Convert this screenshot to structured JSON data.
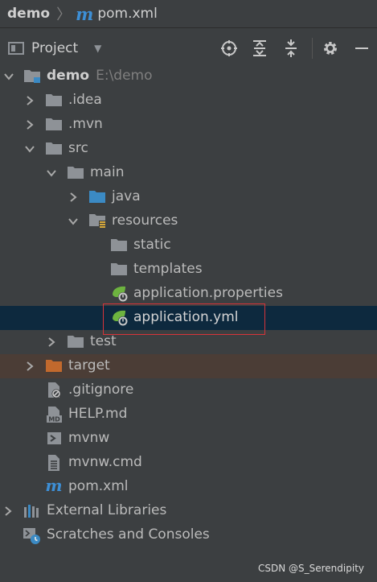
{
  "breadcrumb": {
    "project": "demo",
    "separator": "〉",
    "file_icon": "m",
    "file": "pom.xml"
  },
  "toolbar": {
    "title": "Project",
    "dropdown": "▼",
    "buttons": [
      "locate-icon",
      "expand-all-icon",
      "collapse-all-icon",
      "gear-icon",
      "minimize-icon"
    ]
  },
  "tree": {
    "root": {
      "label": "demo",
      "path": "E:\\demo"
    },
    "idea": ".idea",
    "mvn": ".mvn",
    "src": "src",
    "main": "main",
    "java": "java",
    "resources": "resources",
    "static": "static",
    "templates": "templates",
    "app_props": "application.properties",
    "app_yml": "application.yml",
    "test": "test",
    "target": "target",
    "gitignore": ".gitignore",
    "help": "HELP.md",
    "mvnw": "mvnw",
    "mvnw_cmd": "mvnw.cmd",
    "pom": "pom.xml",
    "ext_libs": "External Libraries",
    "scratches": "Scratches and Consoles"
  },
  "colors": {
    "background": "#3c3f41",
    "selection": "#0d293e",
    "excluded": "#4b3d36",
    "folder": "#8e9297",
    "source_folder": "#3b8ac4",
    "excluded_folder": "#c2692d",
    "spring_green": "#6db33f",
    "highlight": "#d7343a"
  },
  "watermark": "CSDN @S_Serendipity"
}
